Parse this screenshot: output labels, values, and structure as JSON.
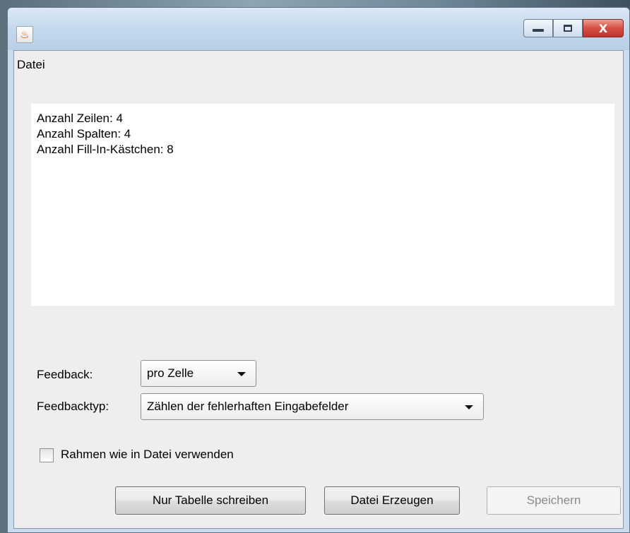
{
  "window": {
    "buttons": {
      "minimize": "–",
      "maximize": "□",
      "close": "X"
    }
  },
  "menubar": {
    "items": [
      "Datei"
    ]
  },
  "info": {
    "lines": [
      "Anzahl Zeilen: 4",
      "Anzahl Spalten: 4",
      "Anzahl Fill-In-Kästchen: 8"
    ]
  },
  "form": {
    "feedback_label": "Feedback:",
    "feedback_value": "pro Zelle",
    "feedbacktyp_label": "Feedbacktyp:",
    "feedbacktyp_value": "Zählen der fehlerhaften Eingabefelder",
    "checkbox_label": "Rahmen wie in Datei verwenden",
    "checkbox_checked": false
  },
  "buttons": {
    "nur_tabelle": "Nur Tabelle schreiben",
    "datei_erzeugen": "Datei Erzeugen",
    "speichern": "Speichern"
  },
  "icons": {
    "app": "java-app-icon"
  }
}
